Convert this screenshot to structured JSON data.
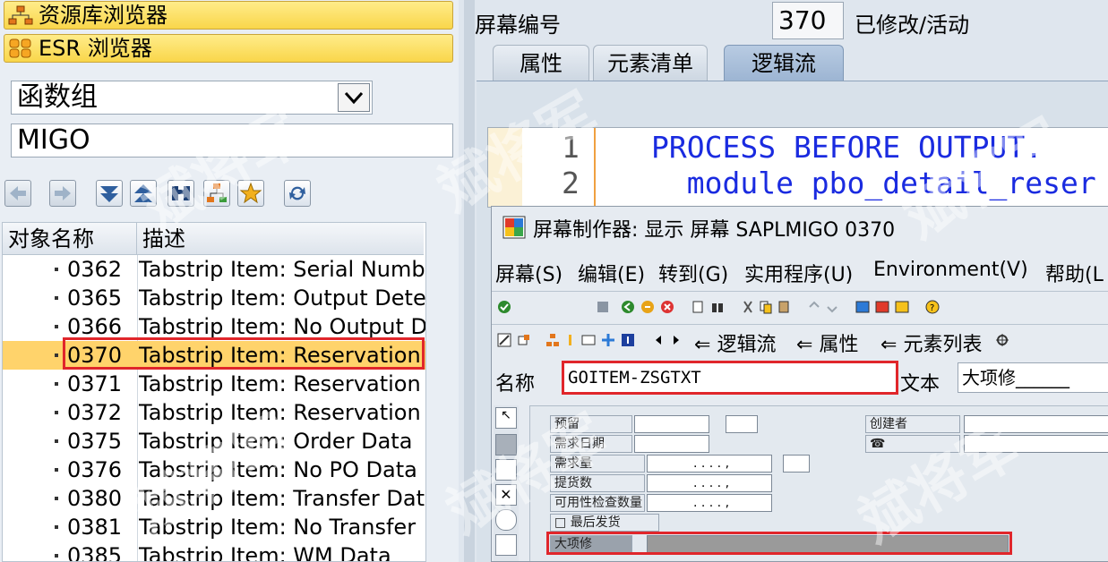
{
  "left": {
    "nav_buttons": [
      {
        "label": "资源库浏览器",
        "icon": "hierarchy-icon"
      },
      {
        "label": "ESR 浏览器",
        "icon": "grid-icon"
      }
    ],
    "object_type": "函数组",
    "object_name": "MIGO",
    "toolbar_icons": [
      "back-icon",
      "forward-icon",
      "collapse-down-icon",
      "collapse-up-icon",
      "binoculars-icon",
      "tree-icon",
      "favorites-icon",
      "refresh-icon"
    ],
    "tree": {
      "columns": [
        "对象名称",
        "描述"
      ],
      "rows": [
        {
          "num": "0362",
          "desc": "Tabstrip Item: Serial Numbe"
        },
        {
          "num": "0365",
          "desc": "Tabstrip Item: Output Dete"
        },
        {
          "num": "0366",
          "desc": "Tabstrip Item: No Output D"
        },
        {
          "num": "0370",
          "desc": "Tabstrip Item: Reservation",
          "selected": true
        },
        {
          "num": "0371",
          "desc": "Tabstrip Item: Reservation"
        },
        {
          "num": "0372",
          "desc": "Tabstrip Item: Reservation"
        },
        {
          "num": "0375",
          "desc": "Tabstrip Item: Order Data"
        },
        {
          "num": "0376",
          "desc": "Tabstrip Item: No PO Data"
        },
        {
          "num": "0380",
          "desc": "Tabstrip Item: Transfer Dat"
        },
        {
          "num": "0381",
          "desc": "Tabstrip Item: No Transfer"
        },
        {
          "num": "0385",
          "desc": "Tabstrip Item: WM Data"
        }
      ]
    }
  },
  "right": {
    "screen_label": "屏幕编号",
    "screen_number": "370",
    "status": "已修改/活动",
    "tabs": [
      {
        "label": "属性"
      },
      {
        "label": "元素清单"
      },
      {
        "label": "逻辑流",
        "active": true
      }
    ],
    "code_lines": [
      {
        "line": "1",
        "text": "PROCESS BEFORE OUTPUT."
      },
      {
        "line": "2",
        "text": "  module pbo_detail_reser"
      }
    ]
  },
  "painter": {
    "title": "屏幕制作器:  显示 屏幕 SAPLMIGO 0370",
    "menu": [
      "屏幕(S)",
      "编辑(E)",
      "转到(G)",
      "实用程序(U)",
      "Environment(V)",
      "帮助(L"
    ],
    "nav_links": [
      "逻辑流",
      "属性",
      "元素列表"
    ],
    "name_label": "名称",
    "name_value": "GOITEM-ZSGTXT",
    "text_label": "文本",
    "text_value": "大项修______",
    "form": {
      "labels": [
        "预留",
        "需求日期",
        "需求量",
        "提货数",
        "可用性检查数量",
        "最后发货",
        "大项修"
      ],
      "creator_label": "创建者",
      "dots": [
        ". . . . ,",
        ". . . . ,",
        ". . . . ,"
      ]
    }
  },
  "watermark": "斌将军",
  "colors": {
    "selection": "#ffd36b",
    "highlight_red": "#e0262b",
    "code_keyword": "#1a2be0"
  }
}
